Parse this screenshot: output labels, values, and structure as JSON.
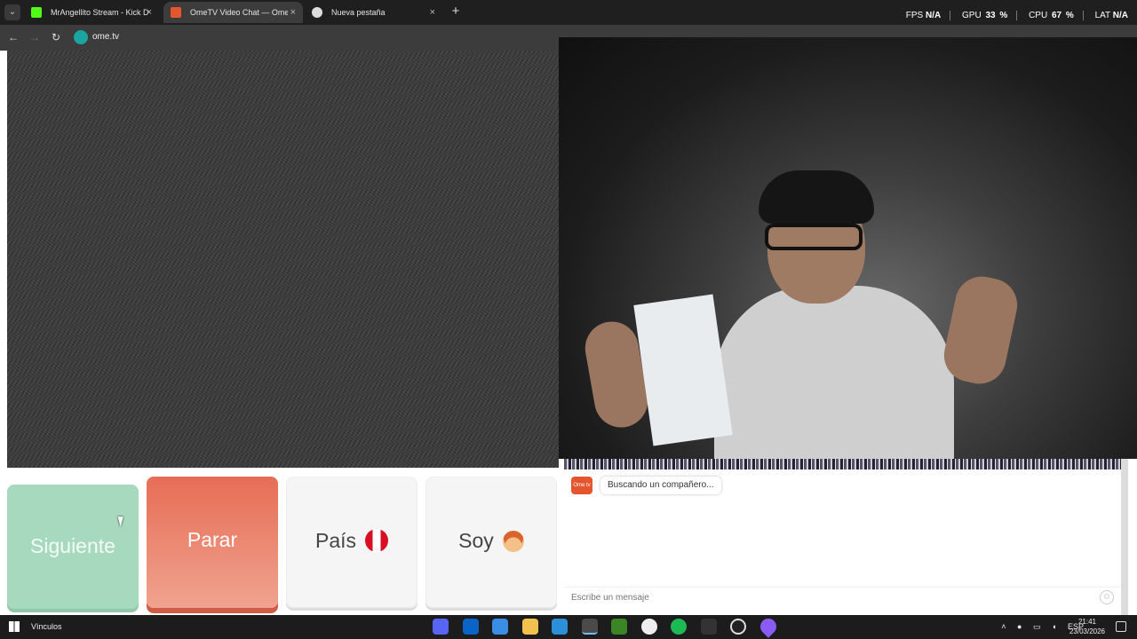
{
  "browser": {
    "tabs": [
      {
        "title": "MrAngellito Stream - Kick Dashb",
        "favicon": "kick-icon",
        "active": false
      },
      {
        "title": "OmeTV Video Chat — Ome",
        "favicon": "ometv-icon",
        "active": true
      },
      {
        "title": "Nueva pestaña",
        "favicon": "chrome-icon",
        "active": false
      }
    ],
    "perf": {
      "fps_label": "FPS",
      "fps_value": "N/A",
      "gpu_label": "GPU",
      "gpu_value": "33",
      "cpu_label": "CPU",
      "cpu_value": "67",
      "lat_label": "LAT",
      "lat_value": "N/A",
      "percent": "%"
    },
    "url": "ome.tv"
  },
  "controls": {
    "next_label": "Siguiente",
    "stop_label": "Parar",
    "country_label": "País",
    "gender_label": "Soy",
    "colors": {
      "next": "#a6d9bd",
      "stop": "#e76d55",
      "neutral": "#f5f5f5"
    }
  },
  "chat": {
    "logo_text": "Ome tv",
    "status_message": "Buscando un compañero...",
    "input_placeholder": "Escribe un mensaje"
  },
  "taskbar": {
    "links_label": "Vínculos",
    "apps": [
      "discord-icon",
      "outlook-icon",
      "store-icon",
      "files-icon",
      "app-f-icon",
      "chrome-icon",
      "minecraft-icon",
      "obs-icon",
      "spotify-icon",
      "epic-icon",
      "speedtest-icon",
      "drop-icon"
    ],
    "language": "ESP",
    "time": "21:41",
    "date": "23/03/2026"
  }
}
